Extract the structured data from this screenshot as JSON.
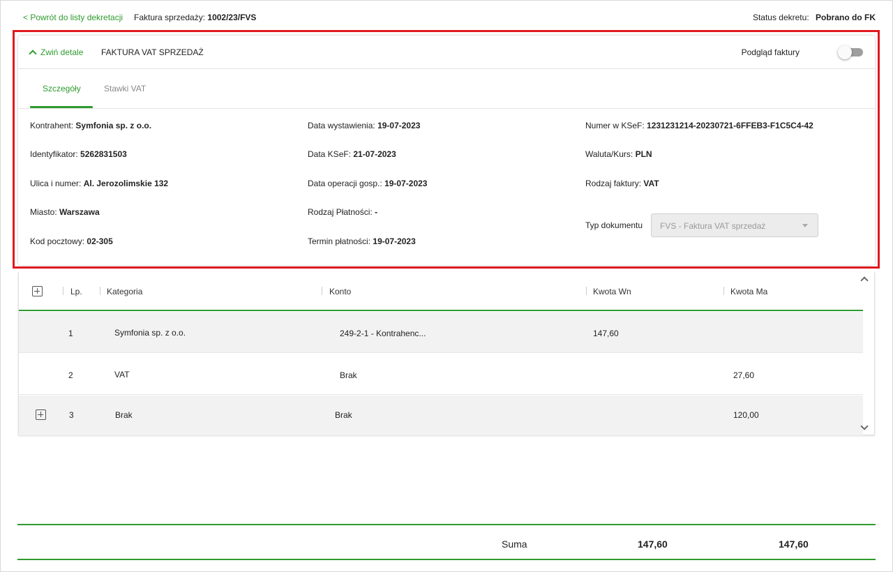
{
  "topbar": {
    "back_link": "< Powrót do listy dekretacji",
    "doc_label": "Faktura sprzedaży:",
    "doc_number": "1002/23/FVS",
    "status_label": "Status dekretu:",
    "status_value": "Pobrano do FK"
  },
  "card": {
    "collapse_label": "Zwiń detale",
    "title": "FAKTURA VAT SPRZEDAŻ",
    "preview_label": "Podgląd faktury",
    "preview_enabled": false,
    "tabs": [
      {
        "label": "Szczegóły",
        "active": true
      },
      {
        "label": "Stawki VAT",
        "active": false
      }
    ]
  },
  "details": {
    "col1": [
      {
        "label": "Kontrahent:",
        "value": "Symfonia sp. z o.o."
      },
      {
        "label": "Identyfikator:",
        "value": "5262831503"
      },
      {
        "label": "Ulica i numer:",
        "value": "Al. Jerozolimskie 132"
      },
      {
        "label": "Miasto:",
        "value": "Warszawa"
      },
      {
        "label": "Kod pocztowy:",
        "value": "02-305"
      }
    ],
    "col2": [
      {
        "label": "Data wystawienia:",
        "value": "19-07-2023"
      },
      {
        "label": "Data KSeF:",
        "value": "21-07-2023"
      },
      {
        "label": "Data operacji gosp.:",
        "value": "19-07-2023"
      },
      {
        "label": "Rodzaj Płatności:",
        "value": "-"
      },
      {
        "label": "Termin płatności:",
        "value": "19-07-2023"
      }
    ],
    "col3": [
      {
        "label": "Numer w KSeF:",
        "value": "1231231214-20230721-6FFEB3-F1C5C4-42"
      },
      {
        "label": "Waluta/Kurs:",
        "value": "PLN"
      },
      {
        "label": "Rodzaj faktury:",
        "value": "VAT"
      }
    ],
    "doc_type_label": "Typ dokumentu",
    "doc_type_value": "FVS - Faktura VAT sprzedaż"
  },
  "grid": {
    "headers": {
      "lp": "Lp.",
      "kategoria": "Kategoria",
      "konto": "Konto",
      "kwota_wn": "Kwota Wn",
      "kwota_ma": "Kwota Ma"
    },
    "rows": [
      {
        "lp": "1",
        "kategoria": "Symfonia sp. z o.o.",
        "konto": "249-2-1 - Kontrahenc...",
        "kwota_wn": "147,60",
        "kwota_ma": "",
        "expandable": false
      },
      {
        "lp": "2",
        "kategoria": "VAT",
        "konto": "Brak",
        "kwota_wn": "",
        "kwota_ma": "27,60",
        "expandable": false
      },
      {
        "lp": "3",
        "kategoria": "Brak",
        "konto": "Brak",
        "kwota_wn": "",
        "kwota_ma": "120,00",
        "expandable": true
      }
    ]
  },
  "summary": {
    "label": "Suma",
    "wn": "147,60",
    "ma": "147,60"
  },
  "colors": {
    "accent": "#2e9b2e",
    "highlight": "#e0191e"
  }
}
